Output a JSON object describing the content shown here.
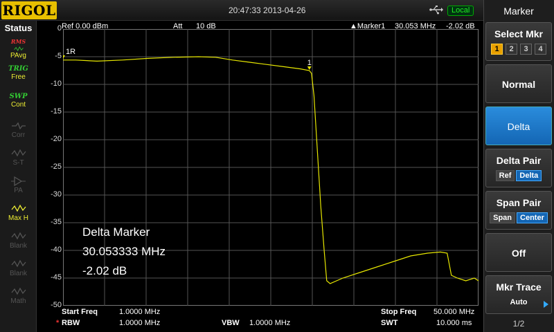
{
  "brand": "RIGOL",
  "datetime": "20:47:33 2013-04-26",
  "local_badge": "Local",
  "status": {
    "title": "Status",
    "items": [
      {
        "a": "RMS",
        "b": "PAvg",
        "icon": "trace-avg-icon",
        "active": true
      },
      {
        "a": "TRIG",
        "b": "Free",
        "icon": "trigger-icon",
        "active": true
      },
      {
        "a": "SWP",
        "b": "Cont",
        "icon": "sweep-icon",
        "active": true
      },
      {
        "a": "",
        "b": "Corr",
        "icon": "correction-icon",
        "active": false
      },
      {
        "a": "",
        "b": "S-T",
        "icon": "source-tracking-icon",
        "active": false
      },
      {
        "a": "",
        "b": "PA",
        "icon": "preamp-icon",
        "active": false
      },
      {
        "a": "",
        "b": "Max H",
        "icon": "max-hold-icon",
        "active": true
      },
      {
        "a": "",
        "b": "Blank",
        "icon": "blank-trace-icon",
        "active": false
      },
      {
        "a": "",
        "b": "Blank",
        "icon": "blank-trace-icon",
        "active": false
      },
      {
        "a": "",
        "b": "Math",
        "icon": "math-icon",
        "active": false
      }
    ]
  },
  "header": {
    "ref": "Ref  0.00 dBm",
    "att_label": "Att",
    "att_value": "10 dB",
    "marker": "▲Marker1",
    "marker_freq": "30.053 MHz",
    "marker_level": "-2.02 dB"
  },
  "delta_readout": {
    "title": "Delta Marker",
    "freq": "30.053333 MHz",
    "level": "-2.02 dB"
  },
  "footer": {
    "start_label": "Start Freq",
    "start_value": "1.0000 MHz",
    "rbw_star": "*",
    "rbw_label": "RBW",
    "rbw_value": "1.0000 MHz",
    "vbw_label": "VBW",
    "vbw_value": "1.0000 MHz",
    "stop_label": "Stop Freq",
    "stop_value": "50.000 MHz",
    "swt_label": "SWT",
    "swt_value": "10.000 ms"
  },
  "menu": {
    "title": "Marker",
    "select_mkr": {
      "label": "Select Mkr",
      "options": [
        "1",
        "2",
        "3",
        "4"
      ],
      "selected": "1"
    },
    "normal": "Normal",
    "delta": "Delta",
    "delta_pair": {
      "label": "Delta Pair",
      "options": [
        "Ref",
        "Delta"
      ],
      "selected": "Delta"
    },
    "span_pair": {
      "label": "Span Pair",
      "options": [
        "Span",
        "Center"
      ],
      "selected": "Center"
    },
    "off": "Off",
    "mkr_trace": {
      "label": "Mkr Trace",
      "value": "Auto"
    },
    "page": "1/2"
  },
  "chart_data": {
    "type": "line",
    "xlabel": "",
    "ylabel": "",
    "xlim": [
      1.0,
      50.0
    ],
    "ylim": [
      -50,
      0
    ],
    "yticks": [
      "0",
      "-5",
      "-10",
      "-15",
      "-20",
      "-25",
      "-30",
      "-35",
      "-40",
      "-45",
      "-50"
    ],
    "grid": true,
    "trace_color": "#e8e800",
    "series": [
      {
        "x": [
          1.0,
          2.5,
          5.0,
          8.0,
          11.0,
          14.0,
          17.0,
          19.0,
          21.0,
          23.0,
          25.0,
          27.0,
          29.0,
          30.05,
          30.3,
          30.6,
          31.0,
          31.4,
          31.8,
          32.1,
          32.5,
          34.0,
          36.0,
          38.0,
          40.0,
          42.0,
          44.0,
          45.5,
          46.3,
          46.8,
          47.5,
          48.5,
          49.5,
          50.0
        ],
        "y": [
          -5.6,
          -5.6,
          -5.8,
          -5.6,
          -5.3,
          -5.1,
          -5.0,
          -5.1,
          -5.6,
          -6.0,
          -6.4,
          -6.8,
          -7.2,
          -7.5,
          -8.0,
          -12.0,
          -22.0,
          -32.0,
          -40.0,
          -45.5,
          -46.0,
          -45.0,
          -44.0,
          -43.0,
          -42.0,
          -41.0,
          -40.5,
          -40.3,
          -40.5,
          -44.5,
          -45.0,
          -45.5,
          -45.0,
          -45.5
        ]
      }
    ],
    "markers": [
      {
        "label": "1R",
        "x": 1.0,
        "y": -5.5
      },
      {
        "label": "1",
        "x": 30.053,
        "y": -7.5
      }
    ]
  }
}
